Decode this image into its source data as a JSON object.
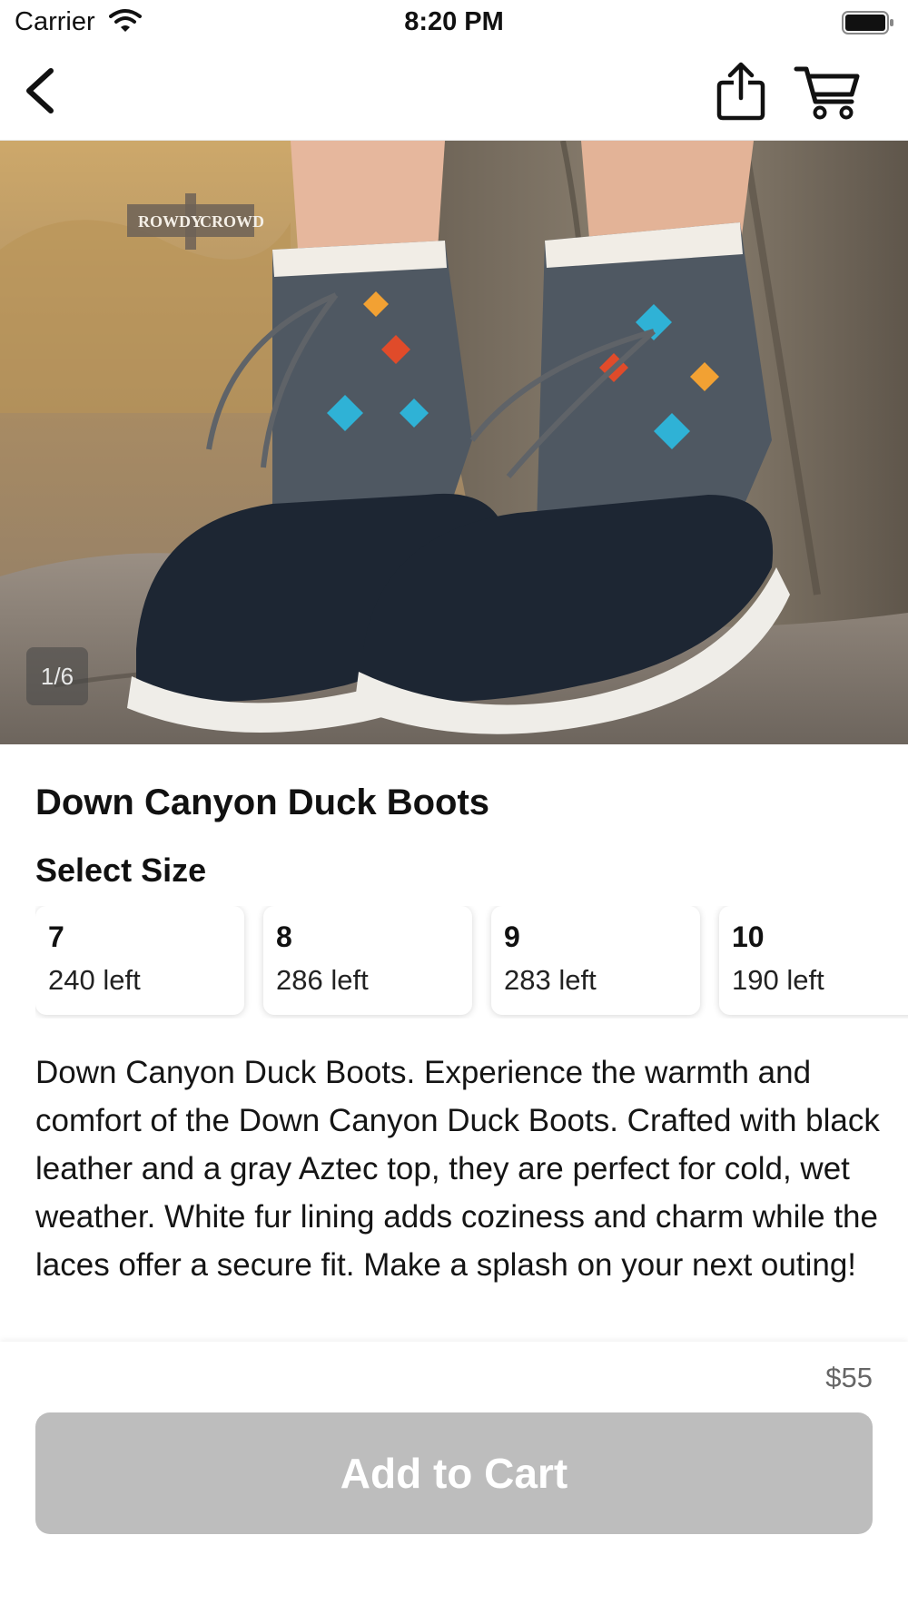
{
  "status_bar": {
    "carrier": "Carrier",
    "time": "8:20 PM",
    "icons": [
      "wifi-icon",
      "battery-icon"
    ]
  },
  "nav": {
    "icons": [
      "back-chevron-icon",
      "share-icon",
      "cart-icon"
    ]
  },
  "gallery": {
    "counter": "1/6",
    "logo_text": "ROWDY CROWD"
  },
  "product": {
    "title": "Down Canyon Duck Boots",
    "select_size_label": "Select Size",
    "sizes": [
      {
        "size": "7",
        "stock": "240 left"
      },
      {
        "size": "8",
        "stock": "286 left"
      },
      {
        "size": "9",
        "stock": "283 left"
      },
      {
        "size": "10",
        "stock": "190 left"
      }
    ],
    "description": "Down Canyon Duck Boots. Experience the warmth and comfort of the Down Canyon Duck Boots. Crafted with black leather and a gray Aztec top, they are perfect for cold, wet weather. White fur lining adds coziness and charm while the laces offer a secure fit. Make a splash on your next outing!"
  },
  "footer": {
    "price": "$55",
    "add_to_cart_label": "Add to Cart"
  },
  "colors": {
    "button_disabled": "#bdbdbd",
    "price_text": "#666666"
  }
}
